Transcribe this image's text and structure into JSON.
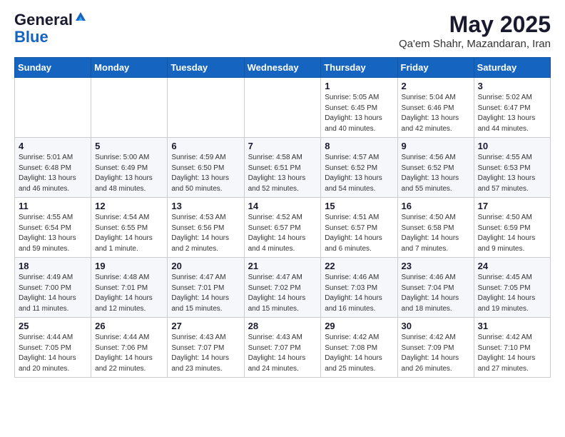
{
  "header": {
    "logo_general": "General",
    "logo_blue": "Blue",
    "month_title": "May 2025",
    "location": "Qa'em Shahr, Mazandaran, Iran"
  },
  "weekdays": [
    "Sunday",
    "Monday",
    "Tuesday",
    "Wednesday",
    "Thursday",
    "Friday",
    "Saturday"
  ],
  "weeks": [
    [
      {
        "day": "",
        "info": ""
      },
      {
        "day": "",
        "info": ""
      },
      {
        "day": "",
        "info": ""
      },
      {
        "day": "",
        "info": ""
      },
      {
        "day": "1",
        "info": "Sunrise: 5:05 AM\nSunset: 6:45 PM\nDaylight: 13 hours\nand 40 minutes."
      },
      {
        "day": "2",
        "info": "Sunrise: 5:04 AM\nSunset: 6:46 PM\nDaylight: 13 hours\nand 42 minutes."
      },
      {
        "day": "3",
        "info": "Sunrise: 5:02 AM\nSunset: 6:47 PM\nDaylight: 13 hours\nand 44 minutes."
      }
    ],
    [
      {
        "day": "4",
        "info": "Sunrise: 5:01 AM\nSunset: 6:48 PM\nDaylight: 13 hours\nand 46 minutes."
      },
      {
        "day": "5",
        "info": "Sunrise: 5:00 AM\nSunset: 6:49 PM\nDaylight: 13 hours\nand 48 minutes."
      },
      {
        "day": "6",
        "info": "Sunrise: 4:59 AM\nSunset: 6:50 PM\nDaylight: 13 hours\nand 50 minutes."
      },
      {
        "day": "7",
        "info": "Sunrise: 4:58 AM\nSunset: 6:51 PM\nDaylight: 13 hours\nand 52 minutes."
      },
      {
        "day": "8",
        "info": "Sunrise: 4:57 AM\nSunset: 6:52 PM\nDaylight: 13 hours\nand 54 minutes."
      },
      {
        "day": "9",
        "info": "Sunrise: 4:56 AM\nSunset: 6:52 PM\nDaylight: 13 hours\nand 55 minutes."
      },
      {
        "day": "10",
        "info": "Sunrise: 4:55 AM\nSunset: 6:53 PM\nDaylight: 13 hours\nand 57 minutes."
      }
    ],
    [
      {
        "day": "11",
        "info": "Sunrise: 4:55 AM\nSunset: 6:54 PM\nDaylight: 13 hours\nand 59 minutes."
      },
      {
        "day": "12",
        "info": "Sunrise: 4:54 AM\nSunset: 6:55 PM\nDaylight: 14 hours\nand 1 minute."
      },
      {
        "day": "13",
        "info": "Sunrise: 4:53 AM\nSunset: 6:56 PM\nDaylight: 14 hours\nand 2 minutes."
      },
      {
        "day": "14",
        "info": "Sunrise: 4:52 AM\nSunset: 6:57 PM\nDaylight: 14 hours\nand 4 minutes."
      },
      {
        "day": "15",
        "info": "Sunrise: 4:51 AM\nSunset: 6:57 PM\nDaylight: 14 hours\nand 6 minutes."
      },
      {
        "day": "16",
        "info": "Sunrise: 4:50 AM\nSunset: 6:58 PM\nDaylight: 14 hours\nand 7 minutes."
      },
      {
        "day": "17",
        "info": "Sunrise: 4:50 AM\nSunset: 6:59 PM\nDaylight: 14 hours\nand 9 minutes."
      }
    ],
    [
      {
        "day": "18",
        "info": "Sunrise: 4:49 AM\nSunset: 7:00 PM\nDaylight: 14 hours\nand 11 minutes."
      },
      {
        "day": "19",
        "info": "Sunrise: 4:48 AM\nSunset: 7:01 PM\nDaylight: 14 hours\nand 12 minutes."
      },
      {
        "day": "20",
        "info": "Sunrise: 4:47 AM\nSunset: 7:01 PM\nDaylight: 14 hours\nand 15 minutes."
      },
      {
        "day": "21",
        "info": "Sunrise: 4:47 AM\nSunset: 7:02 PM\nDaylight: 14 hours\nand 15 minutes."
      },
      {
        "day": "22",
        "info": "Sunrise: 4:46 AM\nSunset: 7:03 PM\nDaylight: 14 hours\nand 16 minutes."
      },
      {
        "day": "23",
        "info": "Sunrise: 4:46 AM\nSunset: 7:04 PM\nDaylight: 14 hours\nand 18 minutes."
      },
      {
        "day": "24",
        "info": "Sunrise: 4:45 AM\nSunset: 7:05 PM\nDaylight: 14 hours\nand 19 minutes."
      }
    ],
    [
      {
        "day": "25",
        "info": "Sunrise: 4:44 AM\nSunset: 7:05 PM\nDaylight: 14 hours\nand 20 minutes."
      },
      {
        "day": "26",
        "info": "Sunrise: 4:44 AM\nSunset: 7:06 PM\nDaylight: 14 hours\nand 22 minutes."
      },
      {
        "day": "27",
        "info": "Sunrise: 4:43 AM\nSunset: 7:07 PM\nDaylight: 14 hours\nand 23 minutes."
      },
      {
        "day": "28",
        "info": "Sunrise: 4:43 AM\nSunset: 7:07 PM\nDaylight: 14 hours\nand 24 minutes."
      },
      {
        "day": "29",
        "info": "Sunrise: 4:42 AM\nSunset: 7:08 PM\nDaylight: 14 hours\nand 25 minutes."
      },
      {
        "day": "30",
        "info": "Sunrise: 4:42 AM\nSunset: 7:09 PM\nDaylight: 14 hours\nand 26 minutes."
      },
      {
        "day": "31",
        "info": "Sunrise: 4:42 AM\nSunset: 7:10 PM\nDaylight: 14 hours\nand 27 minutes."
      }
    ]
  ]
}
